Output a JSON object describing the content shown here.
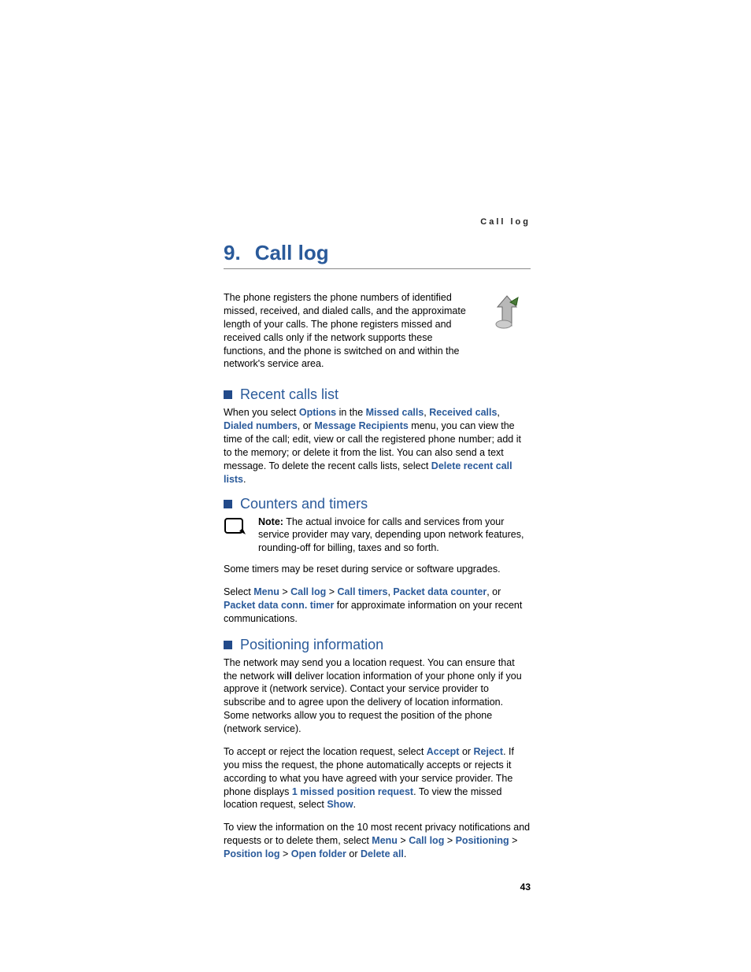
{
  "runningHead": "Call log",
  "chapter": {
    "num": "9.",
    "title": "Call log"
  },
  "intro": "The phone registers the phone numbers of identified missed, received, and dialed calls, and the approximate length of your calls. The phone registers missed and received calls only if the network supports these functions, and the phone is switched on and within the network's service area.",
  "sections": {
    "recent": {
      "title": "Recent calls list",
      "p1_a": "When you select ",
      "t_options": "Options",
      "p1_b": " in the ",
      "t_missed": "Missed calls",
      "p1_c": ", ",
      "t_received": "Received calls",
      "p1_d": ", ",
      "t_dialed": "Dialed numbers",
      "p1_e": ", or ",
      "t_msgrecip": "Message Recipients",
      "p1_f": " menu, you can view the time of the call; edit, view or call the registered phone number; add it to the memory; or delete it from the list. You can also send a text message. To delete the recent calls lists, select ",
      "t_delete": "Delete recent call lists",
      "p1_g": "."
    },
    "counters": {
      "title": "Counters and timers",
      "note_label": "Note:",
      "note_body": " The actual invoice for calls and services from your service provider may vary, depending upon network features, rounding-off for billing, taxes and so forth.",
      "p1": "Some timers may be reset during service or software upgrades.",
      "p2_a": "Select ",
      "t_menu": "Menu",
      "gt1": " > ",
      "t_calllog": "Call log",
      "gt2": " > ",
      "t_calltimers": "Call timers",
      "p2_b": ", ",
      "t_pdc": "Packet data counter",
      "p2_c": ", or ",
      "t_pdct": "Packet data conn. timer",
      "p2_d": " for approximate information on your recent communications."
    },
    "pos": {
      "title": "Positioning information",
      "p1_a": "The network may send you a location request. You can ensure that the network wi",
      "p1_bold_ll": "ll",
      "p1_b": " deliver location information of your phone only if you approve it (network service). Contact your service provider to subscribe and to agree upon the delivery of location information. Some networks allow you to request the position of the phone (network service).",
      "p2_a": "To accept or reject the location request, select ",
      "t_accept": "Accept",
      "p2_b": " or ",
      "t_reject": "Reject",
      "p2_c": ". If you miss the request, the phone automatically accepts or rejects it according to what you have agreed with your service provider. The phone displays ",
      "t_1missed": "1 missed position request",
      "p2_d": ". To view the missed location request, select ",
      "t_show": "Show",
      "p2_e": ".",
      "p3_a": "To view the information on the 10 most recent privacy notifications and requests or to delete them, select ",
      "t_menu": "Menu",
      "gt1": " > ",
      "t_calllog": "Call log",
      "gt2": " > ",
      "t_positioning": "Positioning",
      "gt3": " > ",
      "t_poslog": "Position log",
      "gt4": " > ",
      "t_openfolder": "Open folder",
      "p3_b": " or ",
      "t_deleteall": "Delete all",
      "p3_c": "."
    }
  },
  "pageNumber": "43"
}
